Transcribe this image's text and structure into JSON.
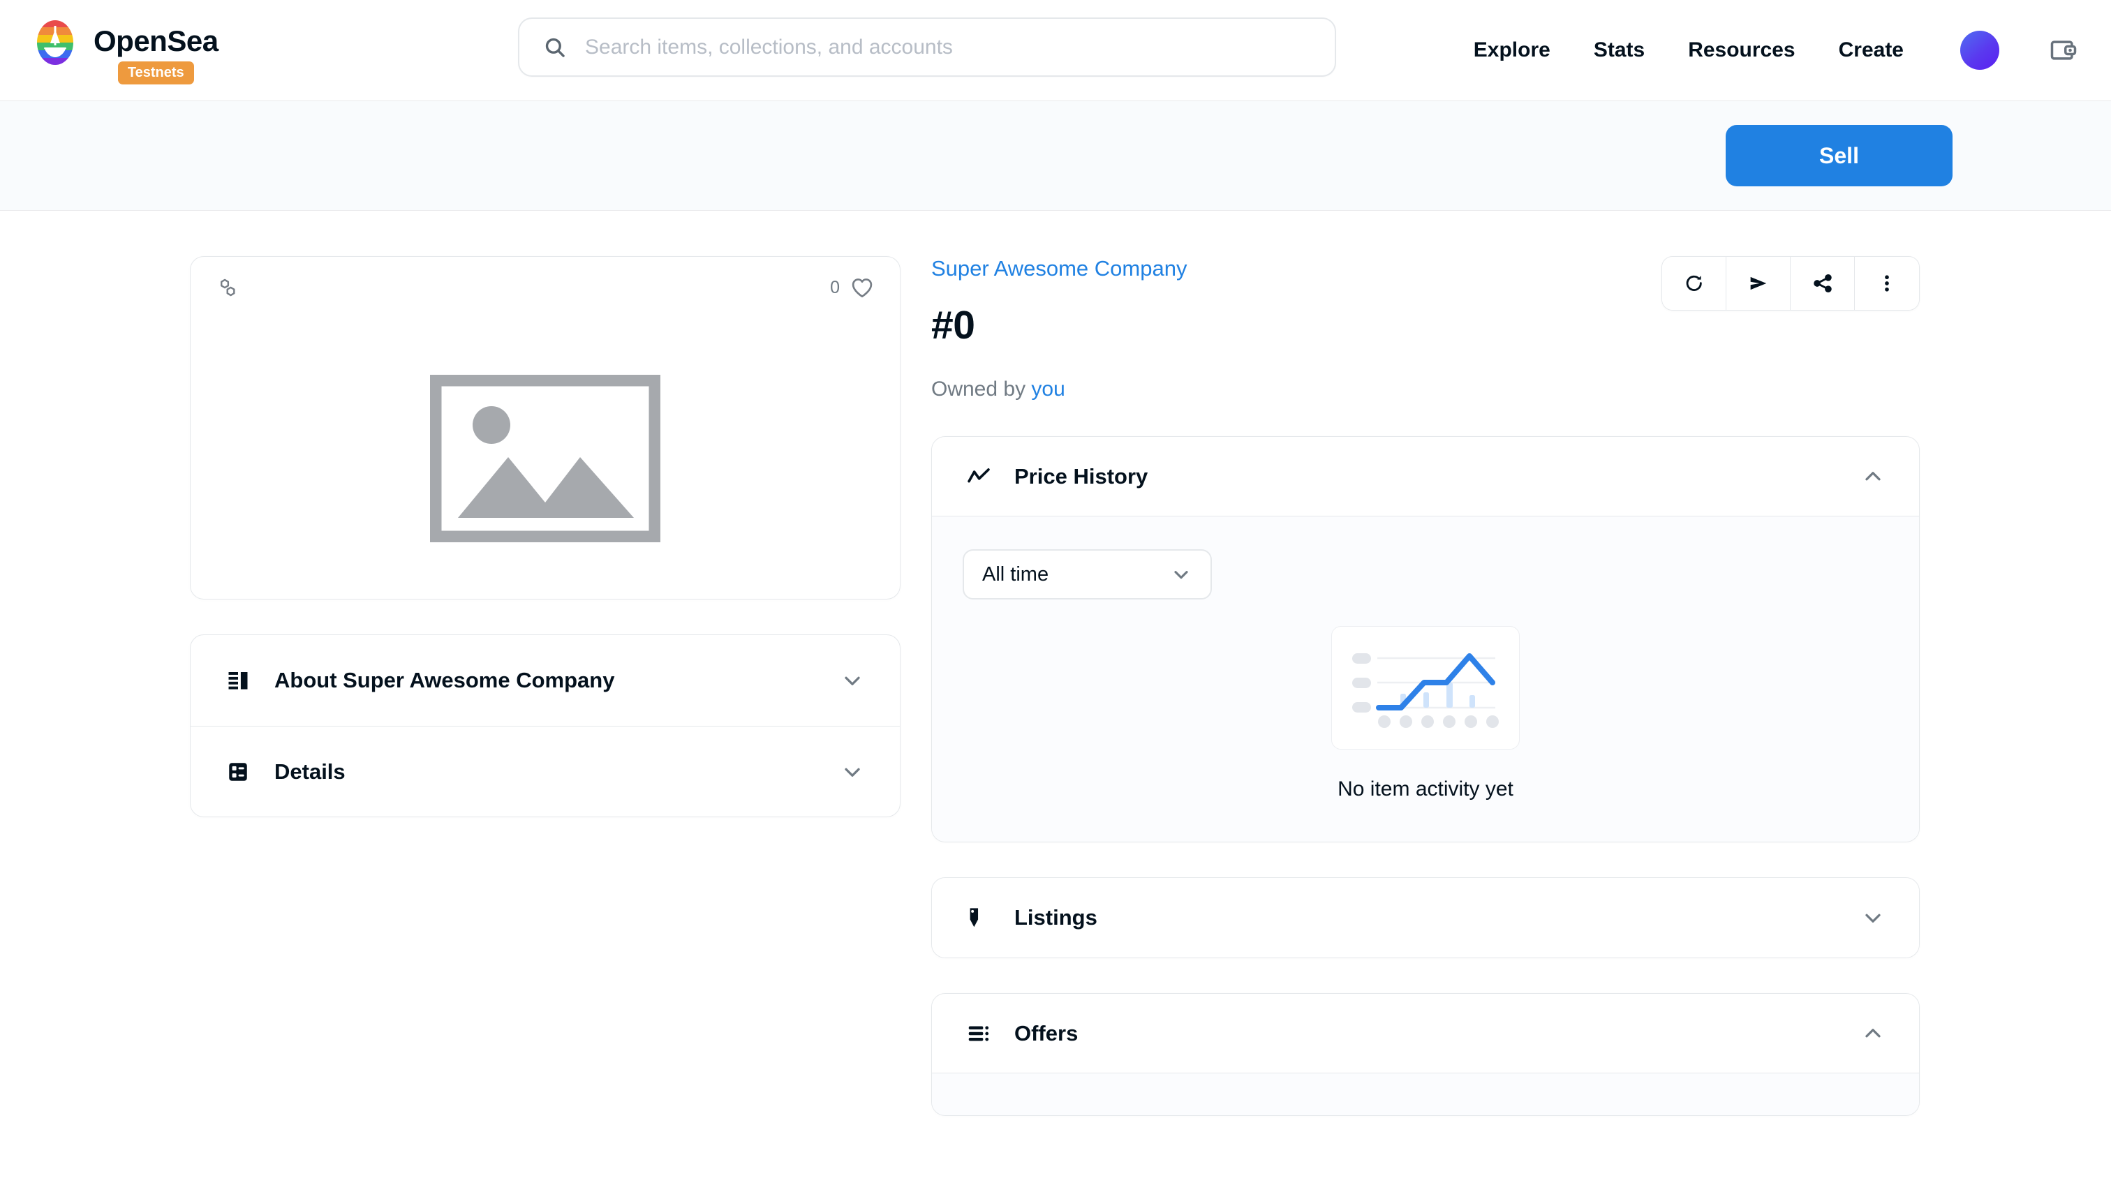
{
  "header": {
    "brand_name": "OpenSea",
    "testnet_badge": "Testnets",
    "logo_icon": "opensea-logo-icon",
    "search": {
      "placeholder": "Search items, collections, and accounts",
      "value": "",
      "icon": "search-icon"
    },
    "nav_links": [
      {
        "label": "Explore"
      },
      {
        "label": "Stats"
      },
      {
        "label": "Resources"
      },
      {
        "label": "Create"
      }
    ],
    "avatar_icon": "avatar-gradient-icon",
    "wallet_icon": "wallet-icon"
  },
  "action_bar": {
    "sell_label": "Sell"
  },
  "item": {
    "chain_icon": "polygon-chain-icon",
    "favorite_count": "0",
    "favorite_icon": "heart-icon",
    "media_placeholder_icon": "image-placeholder-icon",
    "collection_name": "Super Awesome Company",
    "token_title": "#0",
    "owned_prefix": "Owned by",
    "owner_label": "you"
  },
  "item_actions": [
    {
      "name": "refresh-metadata-button",
      "icon": "refresh-icon"
    },
    {
      "name": "transfer-button",
      "icon": "paper-plane-icon"
    },
    {
      "name": "share-button",
      "icon": "share-icon"
    },
    {
      "name": "more-options-button",
      "icon": "more-vertical-icon"
    }
  ],
  "left_accordions": [
    {
      "label": "About Super Awesome Company",
      "icon": "article-icon",
      "expanded": false,
      "chevron": "chevron-down-icon"
    },
    {
      "label": "Details",
      "icon": "details-grid-icon",
      "expanded": false,
      "chevron": "chevron-down-icon"
    }
  ],
  "price_history": {
    "title": "Price History",
    "icon": "trending-up-icon",
    "expanded": true,
    "chevron": "chevron-up-icon",
    "range_select": {
      "value": "All time",
      "chevron": "chevron-down-icon"
    },
    "empty_state_text": "No item activity yet",
    "empty_state_icon": "empty-chart-icon"
  },
  "listings": {
    "title": "Listings",
    "icon": "tag-icon",
    "expanded": false,
    "chevron": "chevron-down-icon"
  },
  "offers": {
    "title": "Offers",
    "icon": "list-icon",
    "expanded": true,
    "chevron": "chevron-up-icon"
  },
  "chart_data": {
    "type": "line",
    "title": "Price History",
    "subtitle": "No item activity yet",
    "range": "All time",
    "categories": [],
    "values": [],
    "series": [],
    "xlabel": "",
    "ylabel": "",
    "empty": true,
    "placeholder_illustration": {
      "line_points": [
        0,
        0,
        1,
        2,
        2,
        4,
        1
      ],
      "bar_values": [
        0.3,
        0.35,
        0.8,
        0.25
      ],
      "gridlines": 3,
      "x_dots": 6,
      "line_color": "#2E81E8",
      "bar_color": "#CFE3FB",
      "dot_color": "#E2E5EA"
    }
  },
  "colors": {
    "accent_blue": "#2081E2",
    "link_blue": "#2081E2",
    "text_dark": "#04111D",
    "text_muted": "#707A83",
    "border": "#E5E8EB",
    "badge_orange": "#EE9A3E",
    "panel_bg": "#FBFCFE",
    "sellbar_bg": "#F9FBFD"
  }
}
